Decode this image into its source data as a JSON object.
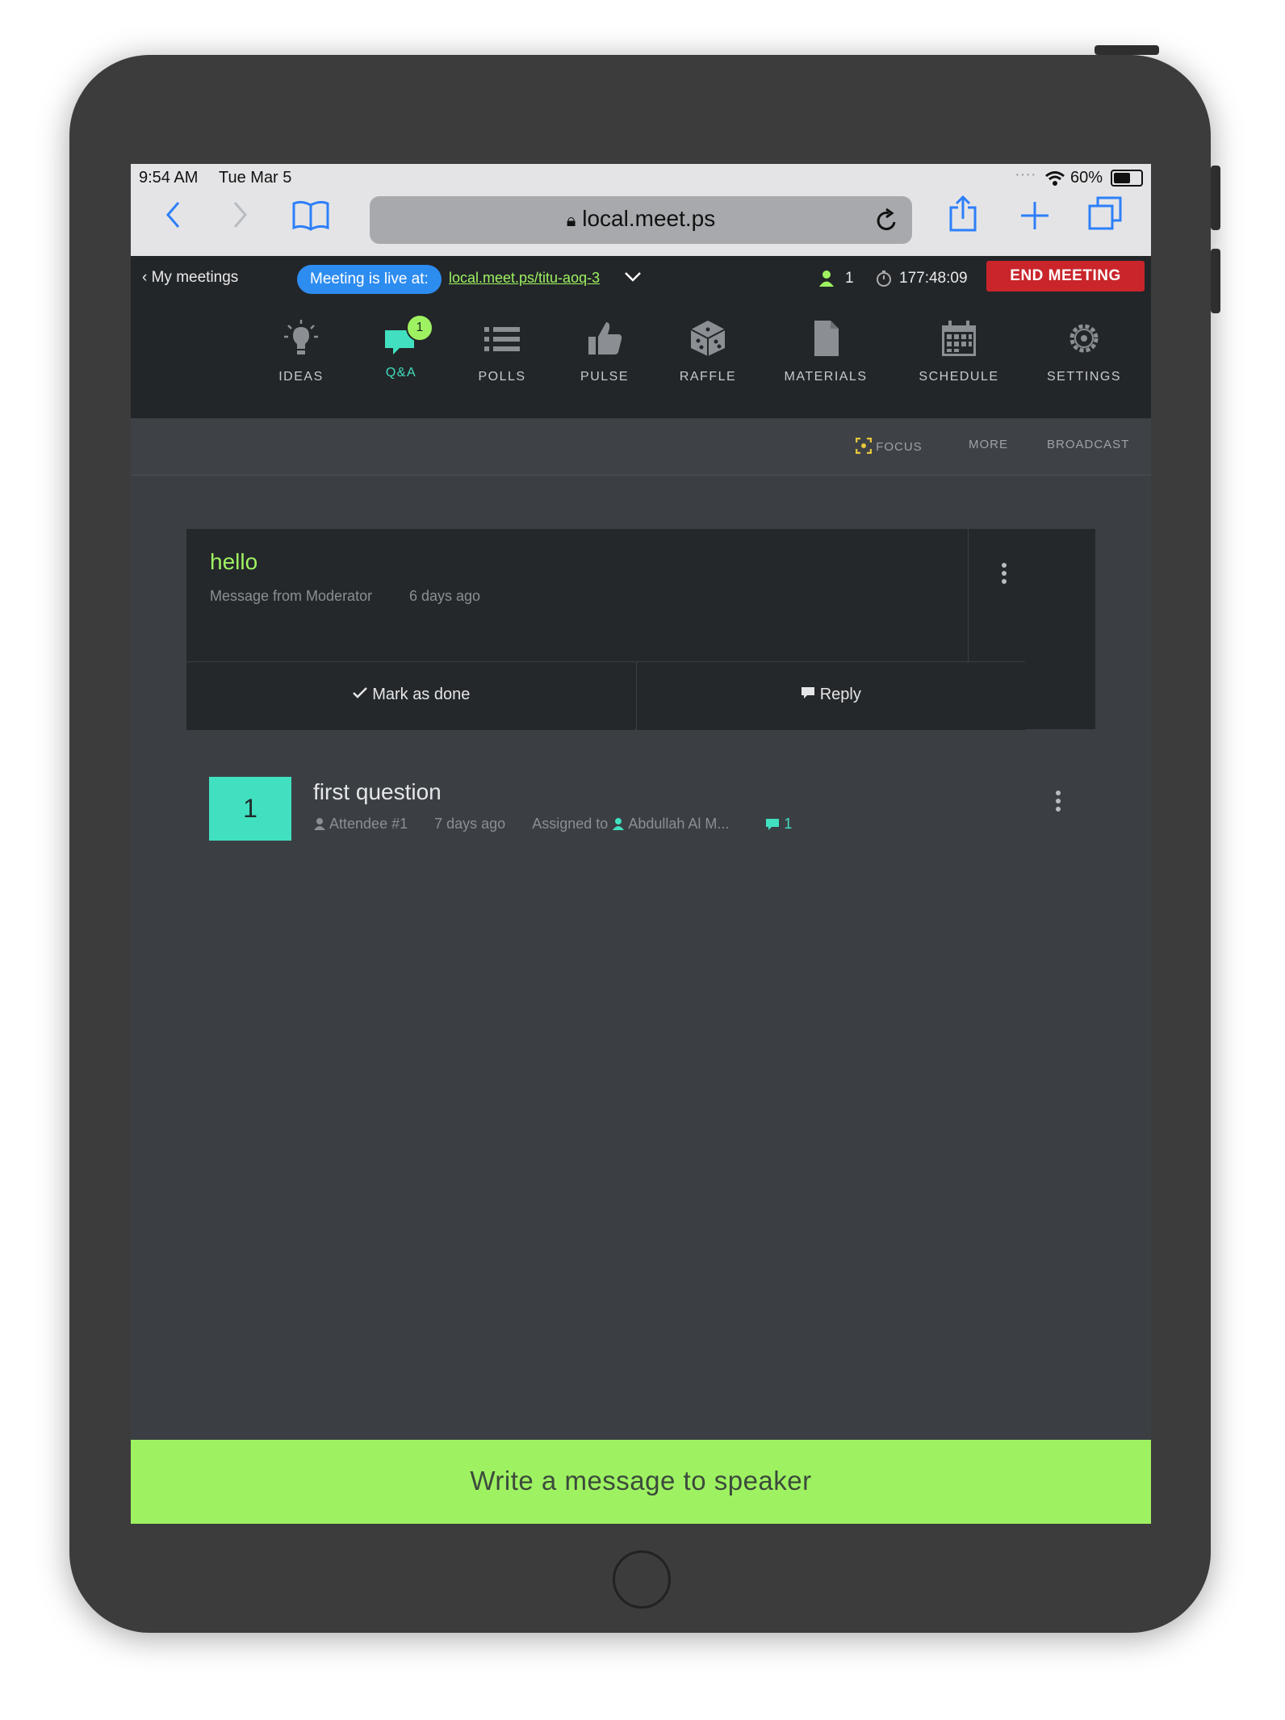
{
  "status_bar": {
    "time": "9:54 AM",
    "date": "Tue Mar 5",
    "battery": "60%"
  },
  "browser": {
    "url": "local.meet.ps"
  },
  "topbar": {
    "back_label": "My meetings",
    "live_badge": "Meeting is live at:",
    "live_link": "local.meet.ps/titu-aoq-3",
    "participants": "1",
    "timer": "177:48:09",
    "end_button": "END MEETING"
  },
  "nav": {
    "items": [
      {
        "label": "IDEAS",
        "icon": "lightbulb-icon"
      },
      {
        "label": "Q&A",
        "icon": "chat-icon",
        "badge": "1",
        "active": true
      },
      {
        "label": "POLLS",
        "icon": "list-icon"
      },
      {
        "label": "PULSE",
        "icon": "thumbs-up-icon"
      },
      {
        "label": "RAFFLE",
        "icon": "dice-icon"
      },
      {
        "label": "MATERIALS",
        "icon": "document-icon"
      },
      {
        "label": "SCHEDULE",
        "icon": "calendar-icon"
      },
      {
        "label": "SETTINGS",
        "icon": "gear-icon"
      }
    ]
  },
  "subbar": {
    "focus": "FOCUS",
    "more": "MORE",
    "broadcast": "BROADCAST"
  },
  "message_card": {
    "title": "hello",
    "from": "Message from Moderator",
    "time": "6 days ago",
    "mark_done": "Mark as done",
    "reply": "Reply"
  },
  "question": {
    "votes": "1",
    "title": "first question",
    "author": "Attendee #1",
    "time": "7 days ago",
    "assigned_label": "Assigned to",
    "assignee": "Abdullah Al M...",
    "replies": "1"
  },
  "bottom_bar": {
    "label": "Write a message to speaker"
  },
  "colors": {
    "accent": "#41e0c0",
    "green": "#9ef261",
    "end": "#c9252b",
    "live_blue": "#2d8cf0"
  }
}
